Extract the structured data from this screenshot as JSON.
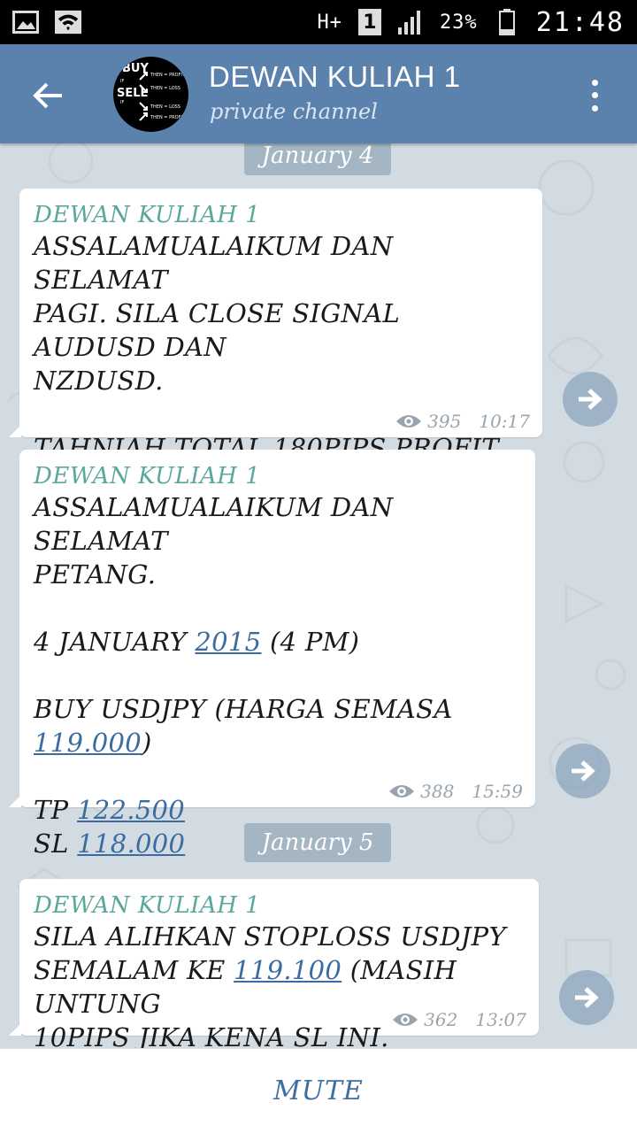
{
  "status_bar": {
    "left_icons": [
      "image-icon",
      "wifi-icon"
    ],
    "network_type": "H+",
    "sim_slot": "1",
    "battery_percent": "23%",
    "time": "21:48"
  },
  "header": {
    "title": "DEWAN KULIAH 1",
    "subtitle": "private channel",
    "avatar": {
      "big_labels": [
        "BUY",
        "SELL"
      ],
      "small_labels": [
        "THEN = PROFIT",
        "THEN = LOSS",
        "THEN = LOSS",
        "THEN = PROFIT"
      ],
      "if_labels": [
        "IF",
        "IF",
        "IF",
        "IF"
      ]
    }
  },
  "dates": {
    "d1": "January 4",
    "d2": "January 5"
  },
  "messages": [
    {
      "sender": "DEWAN KULIAH 1",
      "lines": [
        {
          "text": "ASSALAMUALAIKUM DAN SELAMAT"
        },
        {
          "text": "PAGI. SILA CLOSE SIGNAL AUDUSD DAN"
        },
        {
          "text": "NZDUSD."
        },
        {
          "text": ""
        },
        {
          "text": "TAHNIAH  TOTAL 180PIPS PROFIT."
        }
      ],
      "emoji": "👏",
      "views": "395",
      "time": "10:17"
    },
    {
      "sender": "DEWAN KULIAH 1",
      "lines": [
        {
          "text": "ASSALAMUALAIKUM DAN SELAMAT"
        },
        {
          "text": "PETANG."
        },
        {
          "text": ""
        },
        {
          "pre": "4 JANUARY ",
          "link": "2015",
          "post": " (4 PM)"
        },
        {
          "text": ""
        },
        {
          "pre": "BUY USDJPY (HARGA SEMASA ",
          "link": "119.000",
          "post": ")"
        },
        {
          "text": ""
        },
        {
          "pre": "TP ",
          "link": "122.500",
          "post": ""
        },
        {
          "pre": "SL ",
          "link": "118.000",
          "post": ""
        }
      ],
      "views": "388",
      "time": "15:59"
    },
    {
      "sender": "DEWAN KULIAH 1",
      "lines": [
        {
          "text": "SILA ALIHKAN STOPLOSS USDJPY"
        },
        {
          "pre": "SEMALAM KE ",
          "link": "119.100",
          "post": " (MASIH UNTUNG"
        },
        {
          "text": "10PIPS JIKA KENA SL INI."
        }
      ],
      "views": "362",
      "time": "13:07"
    }
  ],
  "bottom_bar": {
    "mute_label": "MUTE"
  },
  "colors": {
    "header": "#5b82ad",
    "background": "#d3dbe2",
    "sender": "#5aa89c",
    "link": "#3b6c9f",
    "mute": "#3f6f9f"
  }
}
